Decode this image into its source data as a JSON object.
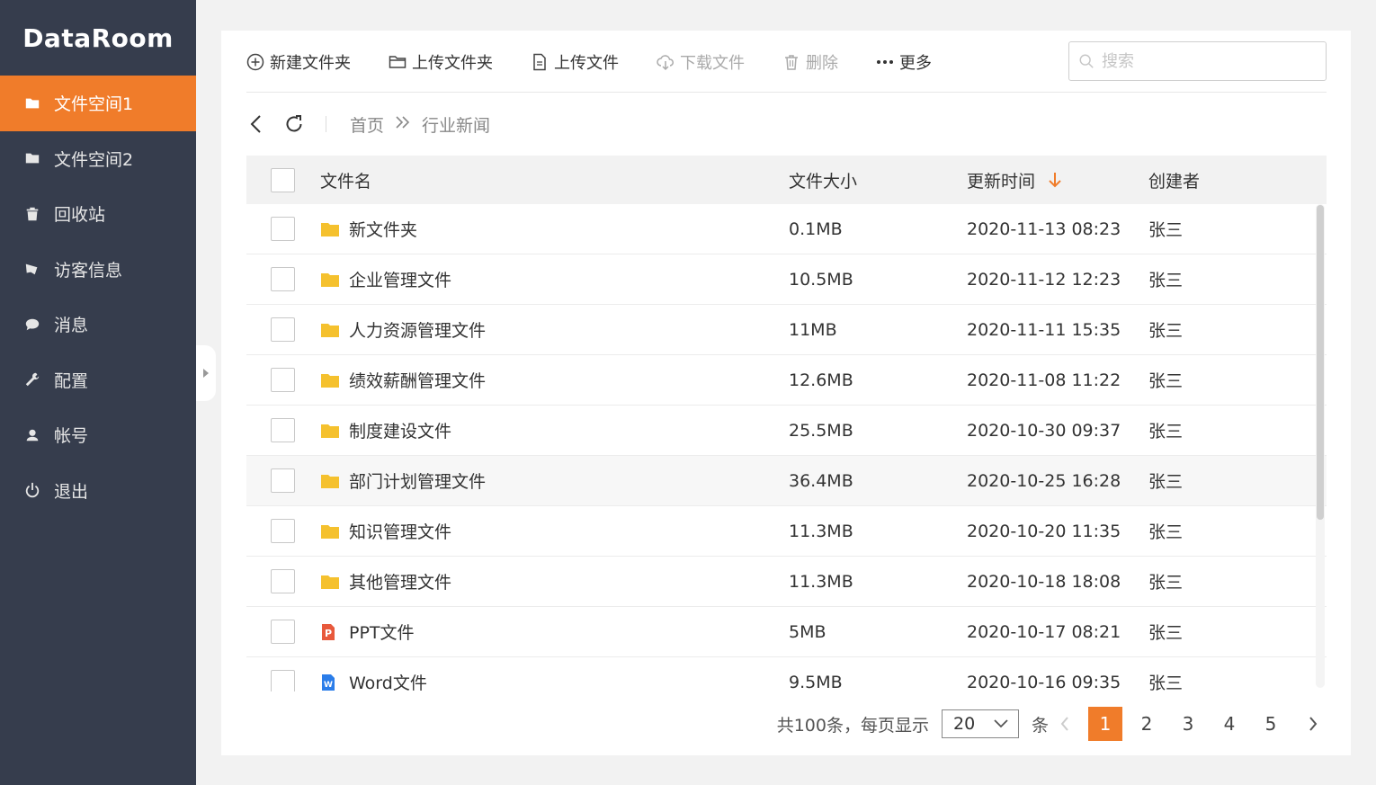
{
  "app": {
    "title": "DataRoom"
  },
  "sidebar": {
    "items": [
      {
        "label": "文件空间1",
        "icon": "folder-icon",
        "active": true
      },
      {
        "label": "文件空间2",
        "icon": "folder-icon",
        "active": false
      },
      {
        "label": "回收站",
        "icon": "trash-icon",
        "active": false
      },
      {
        "label": "访客信息",
        "icon": "visitor-icon",
        "active": false
      },
      {
        "label": "消息",
        "icon": "message-icon",
        "active": false
      },
      {
        "label": "配置",
        "icon": "wrench-icon",
        "active": false
      },
      {
        "label": "帐号",
        "icon": "user-icon",
        "active": false
      },
      {
        "label": "退出",
        "icon": "power-icon",
        "active": false
      }
    ]
  },
  "toolbar": {
    "new_folder": "新建文件夹",
    "upload_folder": "上传文件夹",
    "upload_file": "上传文件",
    "download_file": "下载文件",
    "delete": "删除",
    "more": "更多",
    "search_placeholder": "搜索"
  },
  "breadcrumb": {
    "home": "首页",
    "current": "行业新闻"
  },
  "table": {
    "columns": {
      "name": "文件名",
      "size": "文件大小",
      "time": "更新时间",
      "creator": "创建者"
    },
    "rows": [
      {
        "name": "新文件夹",
        "type": "folder",
        "size": "0.1MB",
        "time": "2020-11-13 08:23",
        "creator": "张三"
      },
      {
        "name": "企业管理文件",
        "type": "folder",
        "size": "10.5MB",
        "time": "2020-11-12 12:23",
        "creator": "张三"
      },
      {
        "name": "人力资源管理文件",
        "type": "folder",
        "size": "11MB",
        "time": "2020-11-11 15:35",
        "creator": "张三"
      },
      {
        "name": "绩效薪酬管理文件",
        "type": "folder",
        "size": "12.6MB",
        "time": "2020-11-08 11:22",
        "creator": "张三"
      },
      {
        "name": "制度建设文件",
        "type": "folder",
        "size": "25.5MB",
        "time": "2020-10-30 09:37",
        "creator": "张三"
      },
      {
        "name": "部门计划管理文件",
        "type": "folder",
        "size": "36.4MB",
        "time": "2020-10-25 16:28",
        "creator": "张三"
      },
      {
        "name": "知识管理文件",
        "type": "folder",
        "size": "11.3MB",
        "time": "2020-10-20 11:35",
        "creator": "张三"
      },
      {
        "name": "其他管理文件",
        "type": "folder",
        "size": "11.3MB",
        "time": "2020-10-18 18:08",
        "creator": "张三"
      },
      {
        "name": "PPT文件",
        "type": "ppt",
        "size": "5MB",
        "time": "2020-10-17 08:21",
        "creator": "张三"
      },
      {
        "name": "Word文件",
        "type": "word",
        "size": "9.5MB",
        "time": "2020-10-16 09:35",
        "creator": "张三"
      }
    ]
  },
  "pagination": {
    "total_text": "共100条，每页显示",
    "page_size": "20",
    "unit": "条",
    "pages": [
      "1",
      "2",
      "3",
      "4",
      "5"
    ],
    "current": "1"
  },
  "colors": {
    "accent": "#f07c2a",
    "sidebar_bg": "#363d4d",
    "folder": "#f5c12e",
    "ppt": "#e8593c",
    "word": "#2b7de9"
  }
}
